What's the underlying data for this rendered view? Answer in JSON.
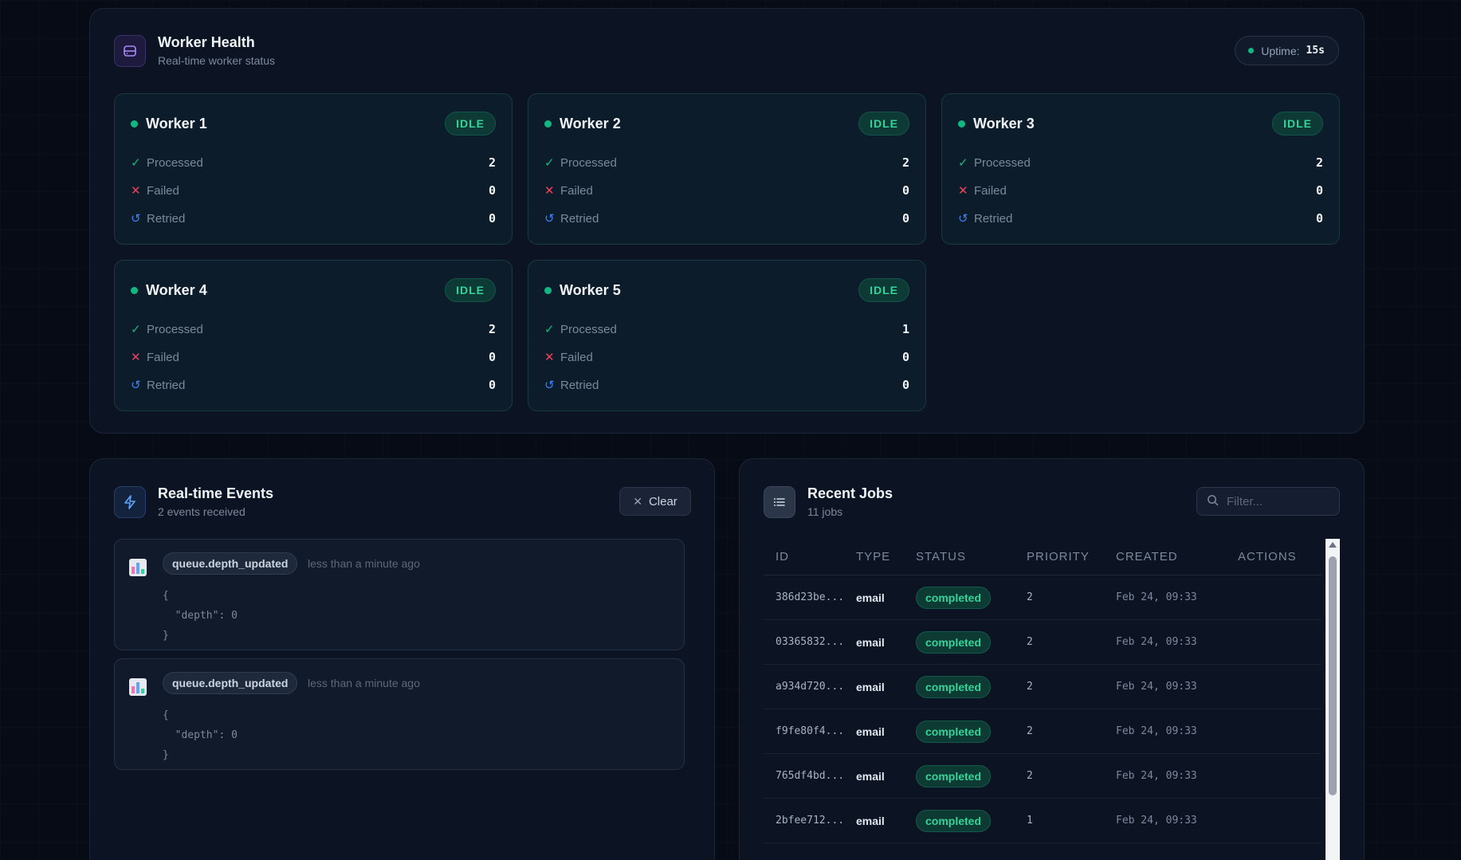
{
  "worker_health": {
    "title": "Worker Health",
    "subtitle": "Real-time worker status",
    "icon": "server-icon",
    "uptime_label": "Uptime:",
    "uptime_value": "15s",
    "stat_labels": {
      "processed": "Processed",
      "failed": "Failed",
      "retried": "Retried"
    },
    "workers": [
      {
        "name": "Worker 1",
        "status": "IDLE",
        "processed": "2",
        "failed": "0",
        "retried": "0"
      },
      {
        "name": "Worker 2",
        "status": "IDLE",
        "processed": "2",
        "failed": "0",
        "retried": "0"
      },
      {
        "name": "Worker 3",
        "status": "IDLE",
        "processed": "2",
        "failed": "0",
        "retried": "0"
      },
      {
        "name": "Worker 4",
        "status": "IDLE",
        "processed": "2",
        "failed": "0",
        "retried": "0"
      },
      {
        "name": "Worker 5",
        "status": "IDLE",
        "processed": "1",
        "failed": "0",
        "retried": "0"
      }
    ]
  },
  "events": {
    "title": "Real-time Events",
    "subtitle": "2 events received",
    "icon": "lightning-icon",
    "clear_label": "Clear",
    "items": [
      {
        "type": "queue.depth_updated",
        "time": "less than a minute ago",
        "json_open": "{",
        "json_body": "  \"depth\": 0",
        "json_close": "}"
      },
      {
        "type": "queue.depth_updated",
        "time": "less than a minute ago",
        "json_open": "{",
        "json_body": "  \"depth\": 0",
        "json_close": "}"
      }
    ]
  },
  "jobs": {
    "title": "Recent Jobs",
    "subtitle": "11 jobs",
    "icon": "list-icon",
    "filter_placeholder": "Filter...",
    "columns": [
      "ID",
      "TYPE",
      "STATUS",
      "PRIORITY",
      "CREATED",
      "ACTIONS"
    ],
    "rows": [
      {
        "id": "386d23be...",
        "type": "email",
        "status": "completed",
        "priority": "2",
        "created": "Feb 24, 09:33"
      },
      {
        "id": "03365832...",
        "type": "email",
        "status": "completed",
        "priority": "2",
        "created": "Feb 24, 09:33"
      },
      {
        "id": "a934d720...",
        "type": "email",
        "status": "completed",
        "priority": "2",
        "created": "Feb 24, 09:33"
      },
      {
        "id": "f9fe80f4...",
        "type": "email",
        "status": "completed",
        "priority": "2",
        "created": "Feb 24, 09:33"
      },
      {
        "id": "765df4bd...",
        "type": "email",
        "status": "completed",
        "priority": "2",
        "created": "Feb 24, 09:33"
      },
      {
        "id": "2bfee712...",
        "type": "email",
        "status": "completed",
        "priority": "1",
        "created": "Feb 24, 09:33"
      }
    ]
  },
  "colors": {
    "accent_green": "#10b981",
    "failed_red": "#f43f5e",
    "retried_blue": "#3b82f6",
    "background": "#070b16"
  }
}
